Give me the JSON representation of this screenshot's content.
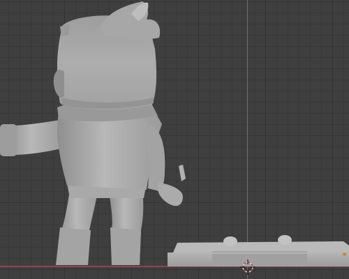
{
  "app": {
    "name": ""
  },
  "viewport": {
    "mode": "solid",
    "grid": true,
    "axis_lines": {
      "z_axis_color": "#5a79a6",
      "x_axis_color": "#9a4550"
    }
  },
  "scene": {
    "objects": [
      {
        "name": "character-figure",
        "material": "clay-grey"
      },
      {
        "name": "display-base",
        "material": "clay-grey"
      }
    ]
  },
  "colors": {
    "background": "#3f3f3f",
    "grid_major": "#353535",
    "grid_minor": "#393939",
    "model_light": "#b4b4b4",
    "model_dark": "#8a8a8a",
    "cursor": "#d0d0d0",
    "origin_marker": "#c98a2e"
  },
  "icons": {
    "cursor": "3d-cursor-icon"
  }
}
